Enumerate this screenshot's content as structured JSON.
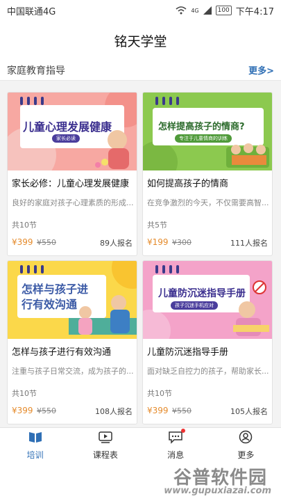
{
  "status_bar": {
    "carrier": "中国联通4G",
    "signal": "4G",
    "battery": "100",
    "time": "下午4:17"
  },
  "header": {
    "title": "铭天学堂"
  },
  "section": {
    "title": "家庭教育指导",
    "more": "更多>"
  },
  "courses": [
    {
      "img_title": "儿童心理发展健康",
      "img_sub": "家长必读",
      "title": "家长必修：儿童心理发展健康",
      "desc": "良好的家庭对孩子心理素质的形成...",
      "lessons": "共10节",
      "price": "¥399",
      "old_price": "¥550",
      "enrolled": "89人报名"
    },
    {
      "img_title": "怎样提高孩子的情商?",
      "img_sub": "专注于儿童情商的训练",
      "title": "如何提高孩子的情商",
      "desc": "在竞争激烈的今天，不仅需要高智...",
      "lessons": "共5节",
      "price": "¥199",
      "old_price": "¥300",
      "enrolled": "111人报名"
    },
    {
      "img_title": "怎样与孩子进行有效沟通",
      "img_sub": "",
      "title": "怎样与孩子进行有效沟通",
      "desc": "注重与孩子日常交流，成为孩子的...",
      "lessons": "共10节",
      "price": "¥399",
      "old_price": "¥550",
      "enrolled": "108人报名"
    },
    {
      "img_title": "儿童防沉迷指导手册",
      "img_sub": "孩子沉迷手机应对",
      "title": "儿童防沉迷指导手册",
      "desc": "面对缺乏自控力的孩子，帮助家长...",
      "lessons": "共10节",
      "price": "¥399",
      "old_price": "¥550",
      "enrolled": "105人报名"
    }
  ],
  "tabs": [
    {
      "label": "培训",
      "icon": "book-icon",
      "active": true
    },
    {
      "label": "课程表",
      "icon": "video-icon",
      "active": false
    },
    {
      "label": "消息",
      "icon": "message-icon",
      "active": false
    },
    {
      "label": "更多",
      "icon": "user-icon",
      "active": false
    }
  ],
  "watermark": {
    "title": "谷普软件园",
    "url": "www.gupuxiazai.com"
  },
  "colors": {
    "accent": "#2f6fb5",
    "price": "#e58b2c",
    "badge": "#e33333"
  }
}
